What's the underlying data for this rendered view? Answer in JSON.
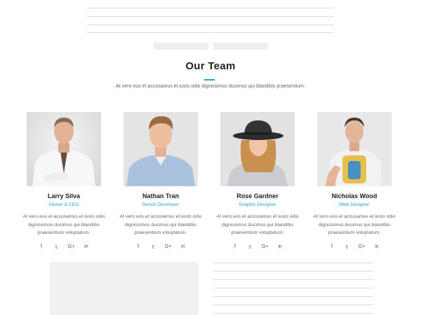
{
  "section": {
    "title": "Our Team",
    "subtitle": "At vero eos et accusamus et iusto odio dignissimos ducimus qui blanditiis praesentium."
  },
  "team": [
    {
      "name": "Larry Silva",
      "role": "Owner & CEO",
      "bio": "At vero eos et accusamus et iusto odio dignissimos ducimus qui blanditiis praesentium voluptatum.",
      "socials": [
        "f",
        "𝕥",
        "G+",
        "in"
      ]
    },
    {
      "name": "Nathan Tran",
      "role": "Senior Developer",
      "bio": "At vero eos et accusamus et iusto odio dignissimos ducimus qui blanditiis praesentium voluptatum.",
      "socials": [
        "f",
        "𝕥",
        "G+",
        "in"
      ]
    },
    {
      "name": "Rose Gardner",
      "role": "Graphic Designer",
      "bio": "At vero eos et accusamus et iusto odio dignissimos ducimus qui blanditiis praesentium voluptatum.",
      "socials": [
        "f",
        "𝕥",
        "G+",
        "in"
      ]
    },
    {
      "name": "Nicholas Wood",
      "role": "Web Designer",
      "bio": "At vero eos et accusamus et iusto odio dignissimos ducimus qui blanditiis praesentium voluptatum.",
      "socials": [
        "f",
        "𝕥",
        "G+",
        "in"
      ]
    }
  ],
  "colors": {
    "accent": "#1aa7e0",
    "heading": "#222222",
    "body_text": "#666666",
    "placeholder": "#f1f1f1"
  }
}
